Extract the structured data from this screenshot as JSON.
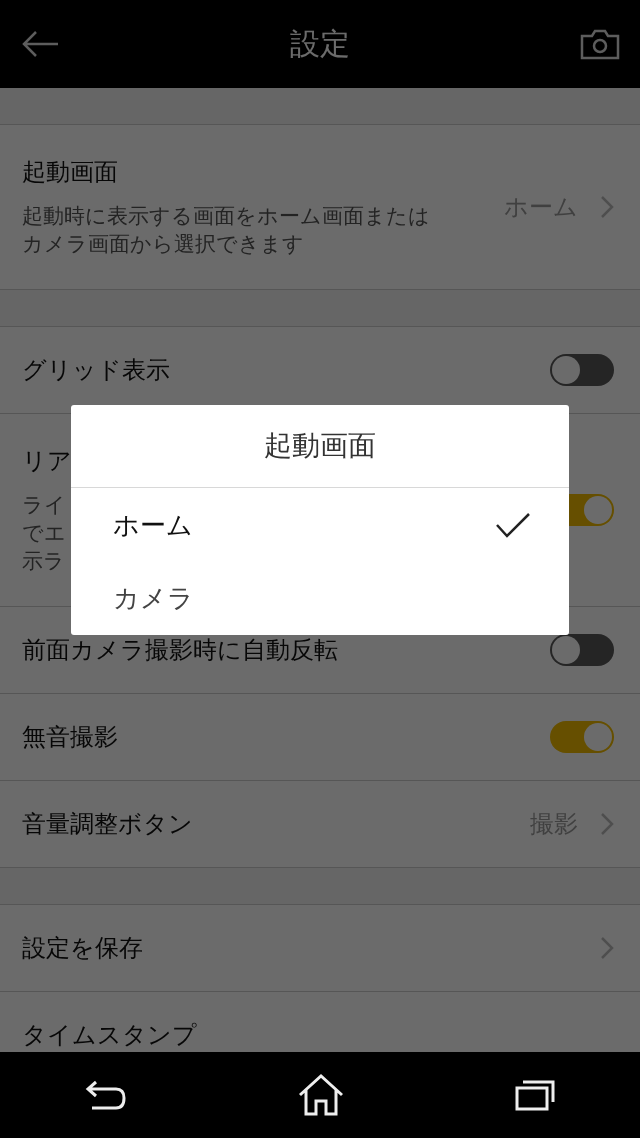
{
  "header": {
    "title": "設定"
  },
  "sections": [
    {
      "rows": [
        {
          "kind": "value",
          "title": "起動画面",
          "description": [
            "起動時に表示する画面をホーム画面または",
            "カメラ画面から選択できます"
          ],
          "value": "ホーム"
        }
      ]
    },
    {
      "rows": [
        {
          "kind": "toggle",
          "title": "グリッド表示",
          "on": false
        },
        {
          "kind": "toggle",
          "title": "リア",
          "description": [
            "ライ",
            "でエ",
            "示ラ"
          ],
          "on": true
        },
        {
          "kind": "toggle",
          "title": "前面カメラ撮影時に自動反転",
          "on": false
        },
        {
          "kind": "toggle",
          "title": "無音撮影",
          "on": true
        },
        {
          "kind": "value",
          "title": "音量調整ボタン",
          "value": "撮影"
        }
      ]
    },
    {
      "rows": [
        {
          "kind": "link",
          "title": "設定を保存"
        },
        {
          "kind": "plain",
          "title": "タイムスタンプ"
        }
      ]
    }
  ],
  "dialog": {
    "title": "起動画面",
    "options": [
      {
        "label": "ホーム",
        "selected": true
      },
      {
        "label": "カメラ",
        "selected": false
      }
    ]
  }
}
